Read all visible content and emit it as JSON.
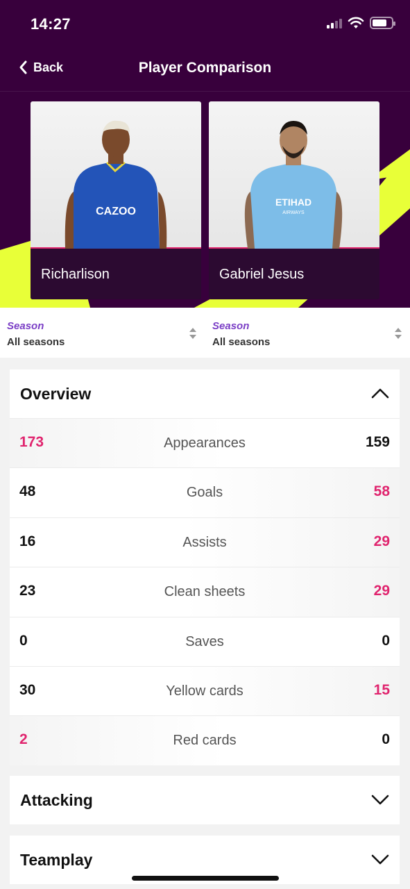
{
  "status_bar": {
    "time": "14:27"
  },
  "nav": {
    "back_label": "Back",
    "title": "Player Comparison"
  },
  "players": [
    {
      "name": "Richarlison",
      "kit_sponsor": "CAZOO"
    },
    {
      "name": "Gabriel Jesus",
      "kit_sponsor": "ETIHAD",
      "kit_sponsor_sub": "AIRWAYS"
    }
  ],
  "season_selectors": [
    {
      "label": "Season",
      "value": "All seasons"
    },
    {
      "label": "Season",
      "value": "All seasons"
    }
  ],
  "overview": {
    "title": "Overview",
    "rows": [
      {
        "left": "173",
        "label": "Appearances",
        "right": "159"
      },
      {
        "left": "48",
        "label": "Goals",
        "right": "58"
      },
      {
        "left": "16",
        "label": "Assists",
        "right": "29"
      },
      {
        "left": "23",
        "label": "Clean sheets",
        "right": "29"
      },
      {
        "left": "0",
        "label": "Saves",
        "right": "0"
      },
      {
        "left": "30",
        "label": "Yellow cards",
        "right": "15"
      },
      {
        "left": "2",
        "label": "Red cards",
        "right": "0"
      }
    ]
  },
  "sections": [
    {
      "title": "Attacking"
    },
    {
      "title": "Teamplay"
    }
  ],
  "colors": {
    "header_bg": "#38003c",
    "accent_yellow": "#e8ff38",
    "highlight_pink": "#e0246e",
    "season_purple": "#7b3fc6"
  }
}
